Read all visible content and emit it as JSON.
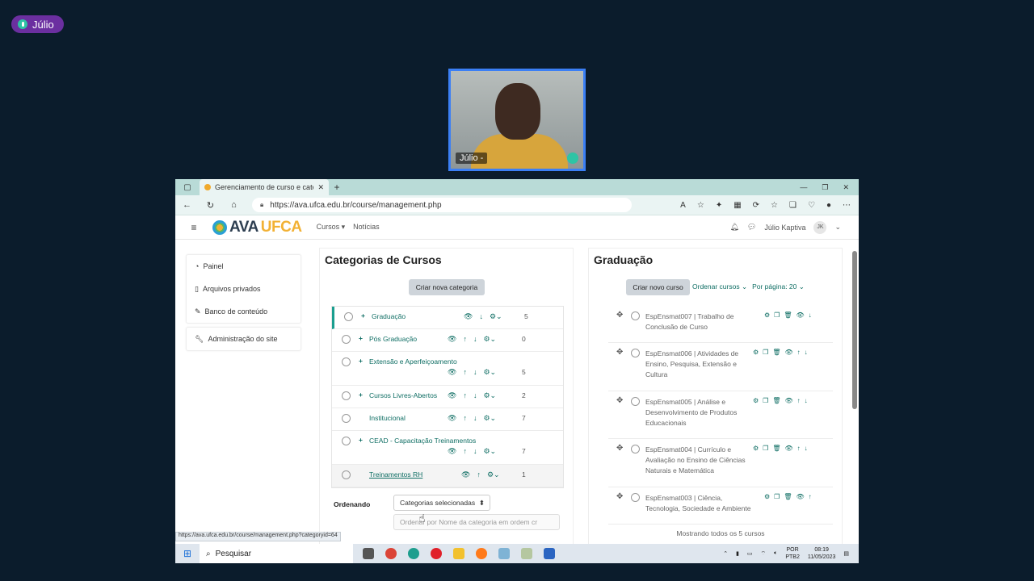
{
  "meeting": {
    "speaker_pill": "Júlio",
    "video_name": "Júlio -"
  },
  "browser": {
    "tab_title": "Gerenciamento de curso e categ",
    "url": "https://ava.ufca.edu.br/course/management.php",
    "status_url": "https://ava.ufca.edu.br/course/management.php?categoryid=64"
  },
  "site": {
    "logo_ava": "AVA",
    "logo_ufca": "UFCA",
    "menu": [
      "Cursos",
      "Notícias"
    ],
    "user_name": "Júlio Kaptiva",
    "user_initials": "JK"
  },
  "drawer": {
    "items": [
      "Painel",
      "Arquivos privados",
      "Banco de conteúdo"
    ],
    "admin": "Administração do site"
  },
  "categories": {
    "title": "Categorias de Cursos",
    "create_button": "Criar nova categoria",
    "rows": [
      {
        "name": "Graduação",
        "count": "5"
      },
      {
        "name": "Pós Graduação",
        "count": "0"
      },
      {
        "name": "Extensão e Aperfeiçoamento",
        "count": "5"
      },
      {
        "name": "Cursos Livres-Abertos",
        "count": "2"
      },
      {
        "name": "Institucional",
        "count": "7"
      },
      {
        "name": "CEAD - Capacitação Treinamentos",
        "count": "7"
      },
      {
        "name": "Treinamentos RH",
        "count": "1"
      }
    ],
    "sort_label": "Ordenando",
    "sort_select": "Categorias selecionadas",
    "sort_option": "Ordenar por Nome da categoria em ordem cr"
  },
  "courses": {
    "title": "Graduação",
    "create_button": "Criar novo curso",
    "sort_link": "Ordenar cursos",
    "per_page": "Por página: 20",
    "rows": [
      {
        "text": "EspEnsmat007 | Trabalho de Conclusão de Curso"
      },
      {
        "text": "EspEnsmat006 | Atividades de Ensino, Pesquisa, Extensão e Cultura"
      },
      {
        "text": "EspEnsmat005 | Análise e Desenvolvimento de Produtos Educacionais"
      },
      {
        "text": "EspEnsmat004 | Currículo e Avaliação no Ensino de Ciências Naturais e Matemática"
      },
      {
        "text": "EspEnsmat003 | Ciência, Tecnologia, Sociedade e Ambiente"
      }
    ],
    "footer": "Mostrando todos os 5 cursos"
  },
  "taskbar": {
    "search": "Pesquisar",
    "lang_top": "POR",
    "lang_bottom": "PTB2",
    "time": "08:19",
    "date": "11/05/2023"
  }
}
